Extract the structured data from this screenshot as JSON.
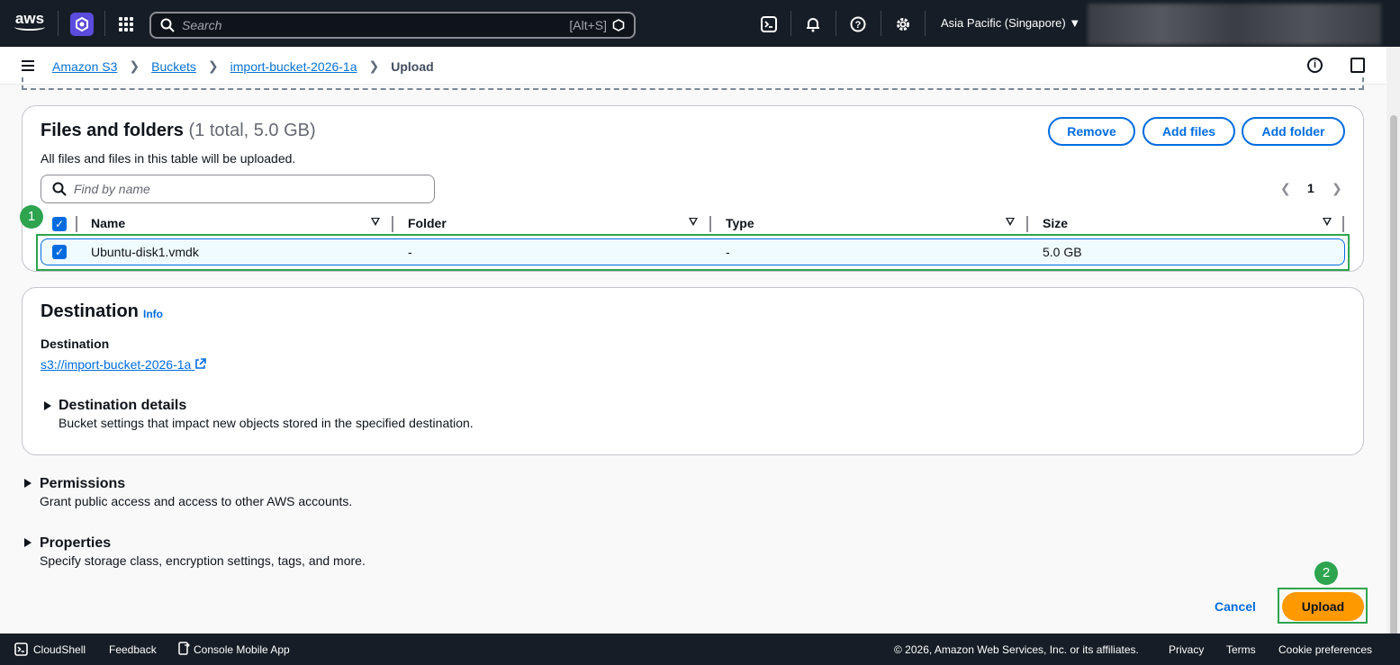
{
  "topnav": {
    "logo": "aws",
    "search_placeholder": "Search",
    "search_shortcut": "[Alt+S]",
    "region": "Asia Pacific (Singapore) ▼"
  },
  "breadcrumb": {
    "items": [
      "Amazon S3",
      "Buckets",
      "import-bucket-2026-1a"
    ],
    "current": "Upload"
  },
  "files": {
    "title": "Files and folders",
    "count": "(1 total, 5.0 GB)",
    "description": "All files and files in this table will be uploaded.",
    "remove_label": "Remove",
    "add_files_label": "Add files",
    "add_folder_label": "Add folder",
    "filter_placeholder": "Find by name",
    "page": "1",
    "columns": [
      "Name",
      "Folder",
      "Type",
      "Size"
    ],
    "rows": [
      {
        "name": "Ubuntu-disk1.vmdk",
        "folder": "-",
        "type": "-",
        "size": "5.0 GB"
      }
    ]
  },
  "destination": {
    "title": "Destination",
    "info": "Info",
    "label": "Destination",
    "uri": "s3://import-bucket-2026-1a",
    "details_title": "Destination details",
    "details_desc": "Bucket settings that impact new objects stored in the specified destination."
  },
  "permissions": {
    "title": "Permissions",
    "desc": "Grant public access and access to other AWS accounts."
  },
  "properties": {
    "title": "Properties",
    "desc": "Specify storage class, encryption settings, tags, and more."
  },
  "actions": {
    "cancel": "Cancel",
    "upload": "Upload"
  },
  "annotations": {
    "step1": "1",
    "step2": "2",
    "color": "#2ea44f"
  },
  "footer": {
    "cloudshell": "CloudShell",
    "feedback": "Feedback",
    "mobile": "Console Mobile App",
    "copyright": "© 2026, Amazon Web Services, Inc. or its affiliates.",
    "privacy": "Privacy",
    "terms": "Terms",
    "cookies": "Cookie preferences"
  }
}
